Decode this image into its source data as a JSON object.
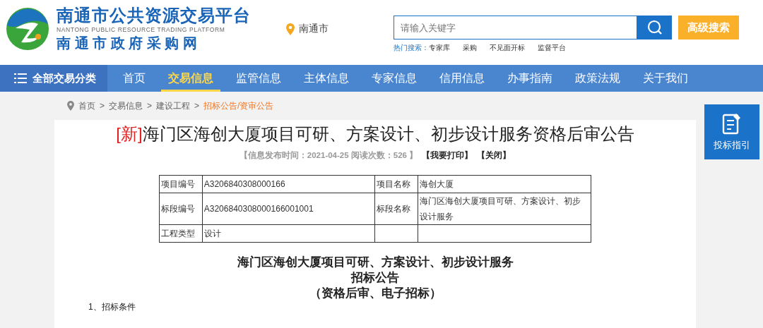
{
  "header": {
    "title": "南通市公共资源交易平台",
    "subtitle_en": "NANTONG PUBLIC RESOURCE TRADING PLATFORM",
    "subtitle": "南 通 市 政 府 采 购 网",
    "location": "南通市",
    "search": {
      "placeholder": "请输入关键字"
    },
    "advanced_search": "高级搜索",
    "hot_label": "热门搜索：",
    "hot_searches": [
      "专家库",
      "采购",
      "不见面开标",
      "监督平台"
    ]
  },
  "nav": {
    "category": "全部交易分类",
    "items": [
      {
        "label": "首页",
        "selected": false
      },
      {
        "label": "交易信息",
        "selected": true
      },
      {
        "label": "监管信息",
        "selected": false
      },
      {
        "label": "主体信息",
        "selected": false
      },
      {
        "label": "专家信息",
        "selected": false
      },
      {
        "label": "信用信息",
        "selected": false
      },
      {
        "label": "办事指南",
        "selected": false
      },
      {
        "label": "政策法规",
        "selected": false
      },
      {
        "label": "关于我们",
        "selected": false
      }
    ]
  },
  "breadcrumb_separator": ">",
  "breadcrumb": [
    {
      "label": "首页",
      "current": false
    },
    {
      "label": "交易信息",
      "current": false
    },
    {
      "label": "建设工程",
      "current": false
    },
    {
      "label": "招标公告/资审公告",
      "current": true
    }
  ],
  "side_button": "投标指引",
  "article": {
    "tag": "[新]",
    "title": "海门区海创大厦项目可研、方案设计、初步设计服务资格后审公告",
    "meta": "【信息发布时间：2021-04-25 阅读次数：526 】",
    "actions": [
      "【我要打印】",
      "【关闭】"
    ],
    "info_table": [
      [
        "项目编号",
        "A3206840308000166",
        "项目名称",
        "海创大厦"
      ],
      [
        "标段编号",
        "A3206840308000166001001",
        "标段名称",
        "海门区海创大厦项目可研、方案设计、初步设计服务"
      ],
      [
        "工程类型",
        "设计"
      ]
    ],
    "headings": [
      "海门区海创大厦项目可研、方案设计、初步设计服务",
      "招标公告",
      "（资格后审、电子招标）"
    ],
    "section": "1、招标条件"
  }
}
